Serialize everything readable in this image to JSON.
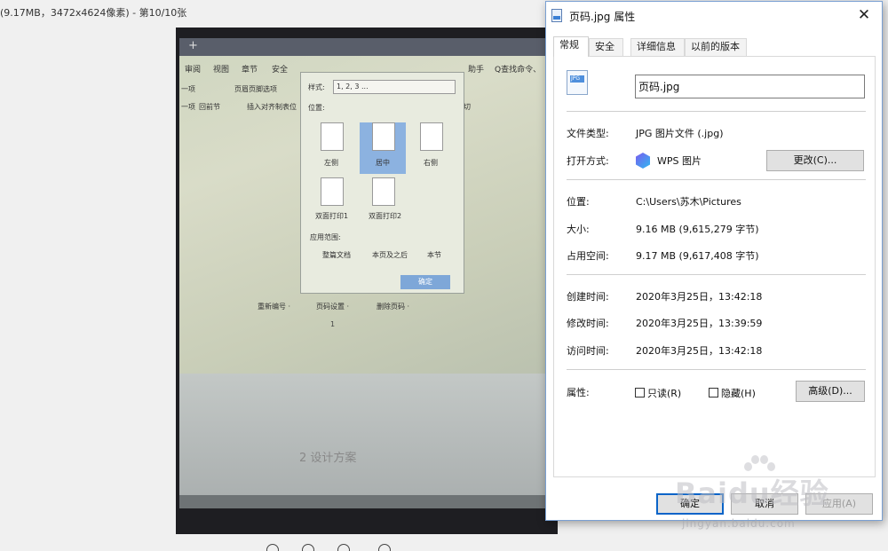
{
  "viewer": {
    "title": "(9.17MB，3472x4624像素) - 第10/10张"
  },
  "photo": {
    "tab_plus": "+",
    "menu": [
      "审阅",
      "视图",
      "章节",
      "安全",
      "助手",
      "Q查找命令、"
    ],
    "tools": [
      "一项",
      "页眉页脚选项",
      "一项",
      "回前节",
      "插入对齐制表位",
      "切"
    ],
    "dialog": {
      "style_label": "样式:",
      "style_value": "1, 2, 3 ...",
      "position_label": "位置:",
      "positions": [
        "左侧",
        "居中",
        "右侧",
        "双面打印1",
        "双面打印2"
      ],
      "range_label": "应用范围:",
      "ranges": [
        "整篇文档",
        "本页及之后",
        "本节"
      ],
      "ok": "确定"
    },
    "page_bar": [
      "重新编号 ·",
      "页码设置 ·",
      "删除页码 ·"
    ],
    "page_number": "1",
    "doc_heading": "2  设计方案"
  },
  "props": {
    "title": "页码.jpg 属性",
    "close": "✕",
    "tabs": [
      "常规",
      "安全",
      "详细信息",
      "以前的版本"
    ],
    "icon_text": "JPG",
    "filename": "页码.jpg",
    "file_type_label": "文件类型:",
    "file_type_value": "JPG 图片文件 (.jpg)",
    "open_with_label": "打开方式:",
    "open_with_value": "WPS 图片",
    "change_button": "更改(C)...",
    "location_label": "位置:",
    "location_value": "C:\\Users\\苏木\\Pictures",
    "size_label": "大小:",
    "size_value": "9.16 MB (9,615,279 字节)",
    "disk_label": "占用空间:",
    "disk_value": "9.17 MB (9,617,408 字节)",
    "created_label": "创建时间:",
    "created_value": "2020年3月25日，13:42:18",
    "modified_label": "修改时间:",
    "modified_value": "2020年3月25日，13:39:59",
    "accessed_label": "访问时间:",
    "accessed_value": "2020年3月25日，13:42:18",
    "attributes_label": "属性:",
    "readonly_label": "只读(R)",
    "hidden_label": "隐藏(H)",
    "advanced_button": "高级(D)...",
    "ok_button": "确定",
    "cancel_button": "取消",
    "apply_button": "应用(A)"
  },
  "watermark": {
    "text": "Baidu经验",
    "url": "jingyan.baidu.com"
  }
}
